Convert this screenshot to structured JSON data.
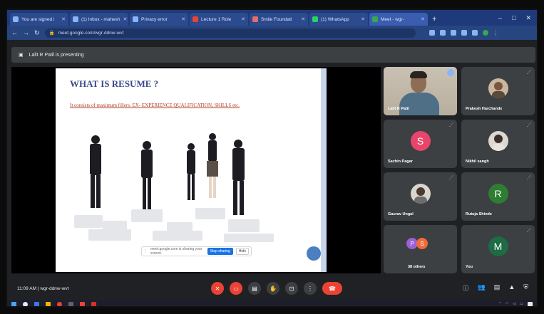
{
  "browser": {
    "tabs": [
      {
        "label": "You are signed i",
        "active": false
      },
      {
        "label": "(1) Inbox - mahesh",
        "active": false
      },
      {
        "label": "Privacy error",
        "active": false
      },
      {
        "label": "Lecture 1 Role",
        "active": false
      },
      {
        "label": "Smile Foundati",
        "active": false
      },
      {
        "label": "(1) WhatsApp",
        "active": false
      },
      {
        "label": "Meet - wgr-",
        "active": true
      }
    ],
    "new_tab": "+",
    "url": "meet.google.com/wgr-ddnw-wvt",
    "window_controls": [
      "–",
      "□",
      "✕"
    ]
  },
  "presenting_bar": {
    "text": "Lalit R Patil is presenting"
  },
  "slide": {
    "title": "WHAT IS RESUME ?",
    "subtitle": "It consists of maximum fillers. EX- EXPERIENCE QUALIFICATION, SKILLS etc."
  },
  "meet_notice": {
    "text": "meet.google.com is sharing your screen.",
    "stop": "Stop sharing",
    "hide": "Hide"
  },
  "participants": [
    {
      "name": "Lalit R Patil",
      "kind": "camera"
    },
    {
      "name": "Prakesh Harchande",
      "kind": "photo"
    },
    {
      "name": "Sachin Pagar",
      "kind": "letter",
      "letter": "S",
      "color": "#e8456b"
    },
    {
      "name": "Nikhil sangh",
      "kind": "photo"
    },
    {
      "name": "Gaurav Ungal",
      "kind": "photo"
    },
    {
      "name": "Rutuja Shinde",
      "kind": "letter",
      "letter": "R",
      "color": "#2e7d32"
    },
    {
      "name": "38 others",
      "kind": "group"
    },
    {
      "name": "You",
      "kind": "letter",
      "letter": "M",
      "color": "#1e6b44"
    }
  ],
  "toolbar": {
    "time": "11:09 AM",
    "meeting_code": "wgr-ddnw-wvt",
    "separator": "|"
  },
  "colors": {
    "accent": "#1a73e8",
    "danger": "#ea4335",
    "surface": "#3c4043",
    "background": "#202124"
  }
}
